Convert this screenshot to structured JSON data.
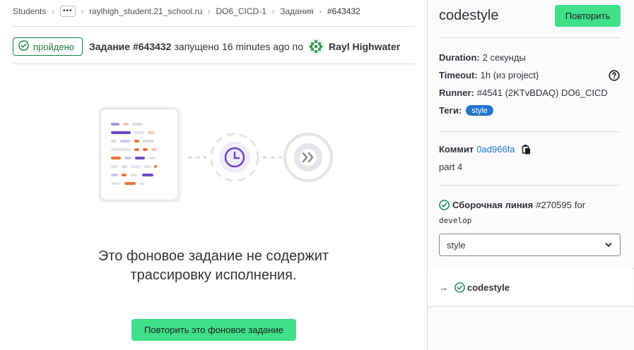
{
  "breadcrumb": {
    "items": [
      "Students",
      "raylhigh_student.21_school.ru",
      "DO6_CICD-1",
      "Задания",
      "#643432"
    ],
    "more": "•••"
  },
  "job": {
    "status": "пройдено",
    "title": "Задание #643432",
    "started_text": "запущено",
    "time_ago": "16 minutes ago",
    "by": "по",
    "user": "Rayl Highwater"
  },
  "empty_state": {
    "title_line1": "Это фоновое задание не содержит",
    "title_line2": "трассировку исполнения.",
    "button": "Повторить это фоновое задание"
  },
  "sidebar": {
    "title": "codestyle",
    "retry_button": "Повторить",
    "duration_label": "Duration:",
    "duration_value": "2 секунды",
    "timeout_label": "Timeout:",
    "timeout_value": "1h (из project)",
    "runner_label": "Runner:",
    "runner_value": "#4541 (2KTvBDAQ) DO6_CICD",
    "tags_label": "Теги:",
    "tag": "style",
    "commit_label": "Коммит",
    "commit_hash": "0ad966fa",
    "commit_message": "part 4",
    "pipeline_label": "Сборочная линия",
    "pipeline_id": "#270595",
    "pipeline_for": "for",
    "branch": "develop",
    "stage_select": "style",
    "job_arrow": "→",
    "job_name": "codestyle"
  },
  "colors": {
    "success": "#108548",
    "confirm_button": "#3fe08a",
    "link": "#1f75cb",
    "tag_bg": "#1f75cb"
  },
  "icons": {
    "status": "status-success-icon",
    "help": "question-icon",
    "copy": "clipboard-icon",
    "select": "chevron-down-icon"
  }
}
